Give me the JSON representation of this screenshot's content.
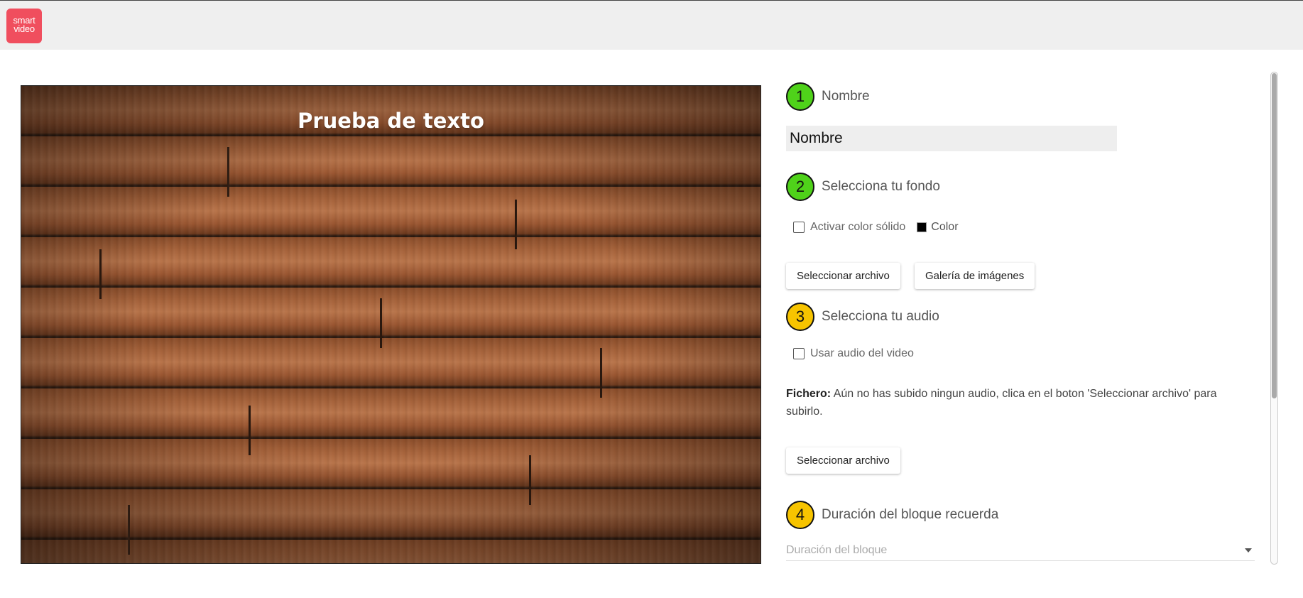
{
  "app": {
    "logo_line1": "smart",
    "logo_line2": "video",
    "brand_color": "#f04e5e"
  },
  "preview": {
    "title": "Prueba de texto"
  },
  "steps": [
    {
      "number": "1",
      "label": "Nombre",
      "color": "#4fd21a"
    },
    {
      "number": "2",
      "label": "Selecciona tu fondo",
      "color": "#4fd21a"
    },
    {
      "number": "3",
      "label": "Selecciona tu audio",
      "color": "#f7c400"
    },
    {
      "number": "4",
      "label": "Duración del bloque recuerda",
      "color": "#f7c400"
    }
  ],
  "name_field": {
    "value": "Nombre"
  },
  "background": {
    "solid_color_label": "Activar color sólido",
    "solid_color_checked": false,
    "color_label": "Color",
    "color_value": "#000000",
    "select_file_label": "Seleccionar archivo",
    "gallery_label": "Galería de imágenes"
  },
  "audio": {
    "use_video_audio_label": "Usar audio del video",
    "use_video_audio_checked": false,
    "file_prefix": "Fichero:",
    "file_message": " Aún no has subido ningun audio, clica en el boton 'Seleccionar archivo' para subirlo.",
    "select_file_label": "Seleccionar archivo"
  },
  "duration": {
    "placeholder": "Duración del bloque"
  }
}
